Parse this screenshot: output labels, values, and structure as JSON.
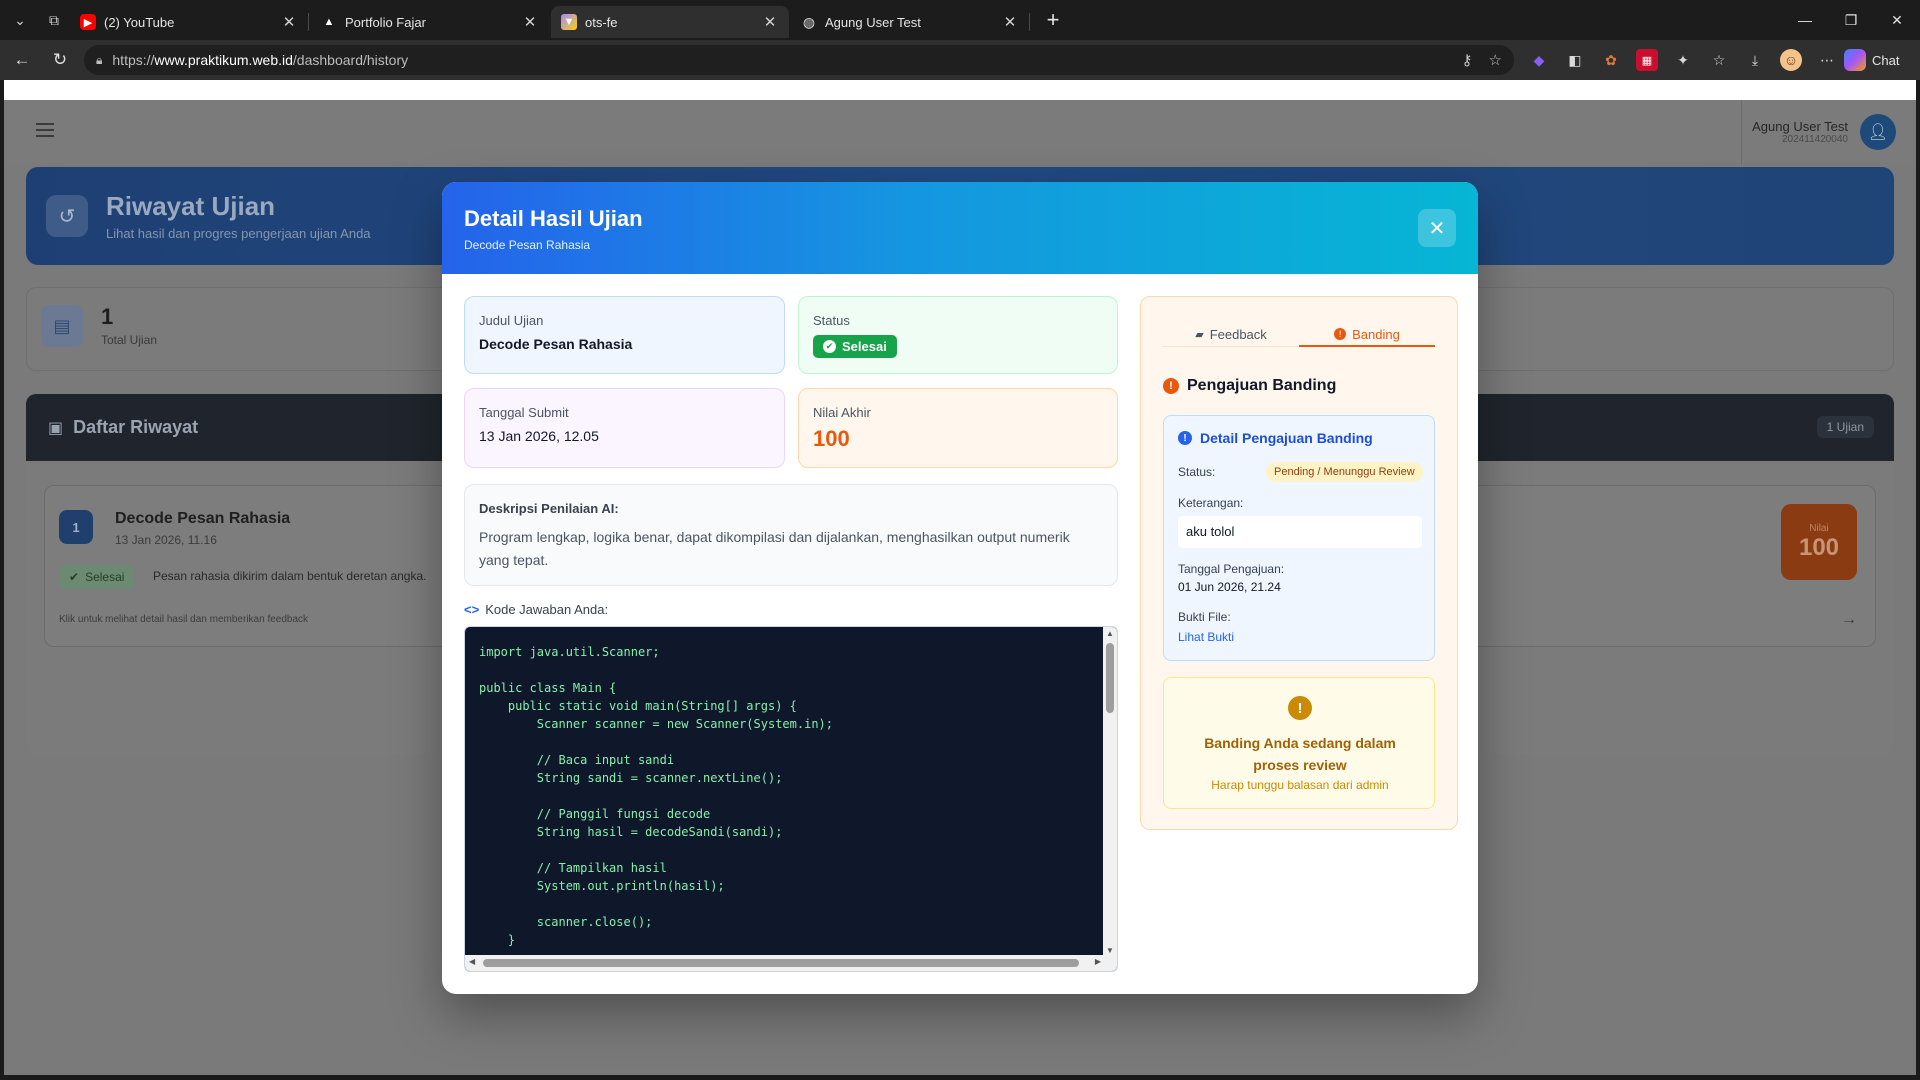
{
  "browser": {
    "tabs": [
      {
        "title": "(2) YouTube",
        "icon": "youtube-icon"
      },
      {
        "title": "Portfolio Fajar",
        "icon": "triangle-icon"
      },
      {
        "title": "ots-fe",
        "icon": "vite-icon"
      },
      {
        "title": "Agung User Test",
        "icon": "globe-icon"
      }
    ],
    "url_prefix": "https://",
    "url_domain": "www.praktikum.web.id",
    "url_path": "/dashboard/history",
    "chat_label": "Chat"
  },
  "header": {
    "user_name": "Agung User Test",
    "user_id": "202411420040"
  },
  "hero": {
    "title": "Riwayat Ujian",
    "subtitle": "Lihat hasil dan progres pengerjaan ujian Anda"
  },
  "stats": {
    "total": "1",
    "total_label": "Total Ujian"
  },
  "history": {
    "heading": "Daftar Riwayat",
    "count": "1 Ujian",
    "item": {
      "number": "1",
      "title": "Decode Pesan Rahasia",
      "date": "13 Jan 2026, 11.16",
      "badge": "Selesai",
      "desc": "Pesan rahasia dikirim dalam bentuk deretan angka.",
      "hint": "Klik untuk melihat detail hasil dan memberikan feedback",
      "score_label": "Nilai",
      "score": "100"
    }
  },
  "modal": {
    "title": "Detail Hasil Ujian",
    "subtitle": "Decode Pesan Rahasia",
    "judul_label": "Judul Ujian",
    "judul_value": "Decode Pesan Rahasia",
    "status_label": "Status",
    "status_value": "Selesai",
    "tanggal_label": "Tanggal Submit",
    "tanggal_value": "13 Jan 2026, 12.05",
    "nilai_label": "Nilai Akhir",
    "nilai_value": "100",
    "desc_label": "Deskripsi Penilaian AI:",
    "desc_text": "Program lengkap, logika benar, dapat dikompilasi dan dijalankan, menghasilkan output numerik yang tepat.",
    "code_label": "Kode Jawaban Anda:",
    "code": "import java.util.Scanner;\n\npublic class Main {\n    public static void main(String[] args) {\n        Scanner scanner = new Scanner(System.in);\n\n        // Baca input sandi\n        String sandi = scanner.nextLine();\n\n        // Panggil fungsi decode\n        String hasil = decodeSandi(sandi);\n\n        // Tampilkan hasil\n        System.out.println(hasil);\n\n        scanner.close();\n    }",
    "side": {
      "tab_feedback": "Feedback",
      "tab_banding": "Banding",
      "banding_title": "Pengajuan Banding",
      "detail_title": "Detail Pengajuan Banding",
      "status_label": "Status:",
      "status_value": "Pending / Menunggu Review",
      "ket_label": "Keterangan:",
      "ket_value": "aku tolol",
      "tgl_label": "Tanggal Pengajuan:",
      "tgl_value": "01 Jun 2026, 21.24",
      "bukti_label": "Bukti File:",
      "bukti_link": "Lihat Bukti",
      "review_title": "Banding Anda sedang dalam proses review",
      "review_sub": "Harap tunggu balasan dari admin"
    }
  }
}
